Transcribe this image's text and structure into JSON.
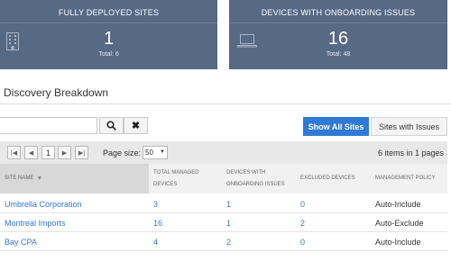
{
  "cards": [
    {
      "title": "FULLY DEPLOYED SITES",
      "value": "1",
      "total": "Total: 6",
      "icon": "building-icon"
    },
    {
      "title": "DEVICES WITH ONBOARDING ISSUES",
      "value": "16",
      "total": "Total: 48",
      "icon": "laptop-icon"
    }
  ],
  "section": {
    "title": "Discovery Breakdown"
  },
  "search": {
    "value": "",
    "placeholder": ""
  },
  "buttons": {
    "search_glyph": "🔍",
    "clear_glyph": "✖"
  },
  "tabs": [
    {
      "label": "Show All Sites",
      "active": true
    },
    {
      "label": "Sites with Issues",
      "active": false
    }
  ],
  "pager": {
    "current_page": "1",
    "page_size_label": "Page size:",
    "page_size": "50",
    "items_info": "6 items in 1 pages"
  },
  "table": {
    "columns": [
      {
        "line1": "SITE NAME",
        "line2": ""
      },
      {
        "line1": "TOTAL MANAGED",
        "line2": "DEVICES"
      },
      {
        "line1": "DEVICES WITH",
        "line2": "ONBOARDING ISSUES"
      },
      {
        "line1": "EXCLUDED DEVICES",
        "line2": ""
      },
      {
        "line1": "MANAGEMENT POLICY",
        "line2": ""
      }
    ],
    "rows": [
      {
        "site": "Umbrella Corporation",
        "managed": "3",
        "issues": "1",
        "excluded": "0",
        "policy": "Auto-Include"
      },
      {
        "site": "Montreal Imports",
        "managed": "16",
        "issues": "1",
        "excluded": "2",
        "policy": "Auto-Exclude"
      },
      {
        "site": "Bay CPA",
        "managed": "4",
        "issues": "2",
        "excluded": "0",
        "policy": "Auto-Include"
      }
    ]
  },
  "colors": {
    "card_bg": "#566985",
    "accent": "#2f7ad6",
    "header_bg": "#f1f1f1"
  }
}
